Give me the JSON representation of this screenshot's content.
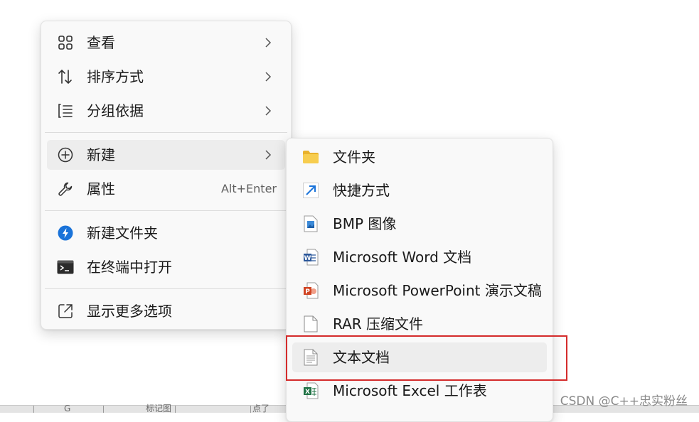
{
  "context_menu": {
    "items": [
      {
        "label": "查看",
        "icon": "grid-view-icon",
        "has_submenu": true
      },
      {
        "label": "排序方式",
        "icon": "sort-arrows-icon",
        "has_submenu": true
      },
      {
        "label": "分组依据",
        "icon": "group-list-icon",
        "has_submenu": true
      },
      {
        "label": "新建",
        "icon": "plus-circle-icon",
        "has_submenu": true
      },
      {
        "label": "属性",
        "icon": "wrench-icon",
        "shortcut": "Alt+Enter"
      },
      {
        "label": "新建文件夹",
        "icon": "lightning-circle-icon"
      },
      {
        "label": "在终端中打开",
        "icon": "terminal-icon"
      },
      {
        "label": "显示更多选项",
        "icon": "open-external-icon"
      }
    ]
  },
  "new_submenu": {
    "items": [
      {
        "label": "文件夹",
        "icon": "folder-icon"
      },
      {
        "label": "快捷方式",
        "icon": "shortcut-arrow-icon"
      },
      {
        "label": "BMP 图像",
        "icon": "bmp-image-icon"
      },
      {
        "label": "Microsoft Word 文档",
        "icon": "word-icon"
      },
      {
        "label": "Microsoft PowerPoint 演示文稿",
        "icon": "powerpoint-icon"
      },
      {
        "label": "RAR 压缩文件",
        "icon": "blank-file-icon"
      },
      {
        "label": "文本文档",
        "icon": "text-document-icon"
      },
      {
        "label": "Microsoft Excel 工作表",
        "icon": "excel-icon"
      }
    ]
  },
  "colors": {
    "menu_bg": "#f9f9f9",
    "hover_bg": "#ededed",
    "highlight_border": "#d42b2b",
    "accent_blue": "#1a73d9",
    "folder_yellow": "#f4c542",
    "word_blue": "#2b579a",
    "powerpoint_red": "#d04423",
    "excel_green": "#217346"
  },
  "watermark": "CSDN @C++忠实粉丝",
  "taskbar_fragments": [
    "G",
    "标记图",
    "点了"
  ]
}
